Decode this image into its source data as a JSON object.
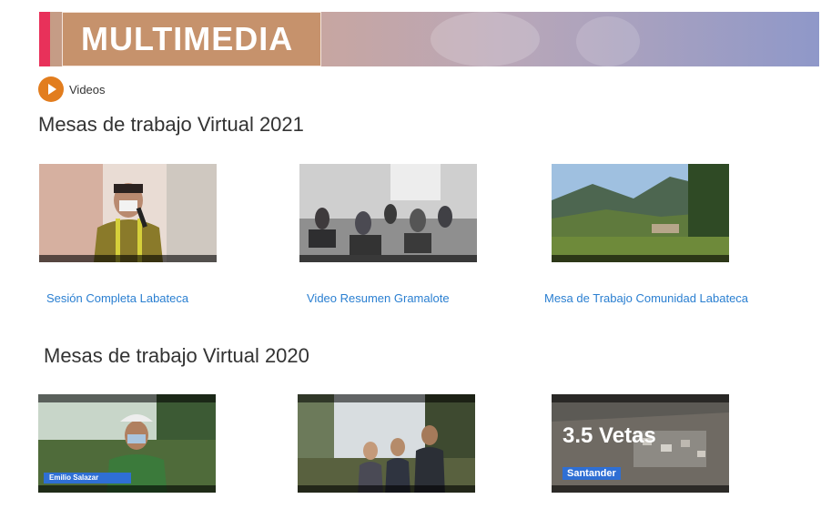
{
  "header": {
    "title": "MULTIMEDIA"
  },
  "videos_label": "Videos",
  "sections": [
    {
      "title": "Mesas de trabajo Virtual 2021",
      "items": [
        {
          "label": "Sesión Completa Labateca"
        },
        {
          "label": "Video Resumen Gramalote"
        },
        {
          "label": "Mesa de Trabajo Comunidad Labateca"
        }
      ]
    },
    {
      "title": "Mesas de trabajo Virtual 2020",
      "items": [
        {
          "overlay": "Emilio Salazar"
        },
        {},
        {
          "big_text": "3.5 Vetas",
          "sub_text": "Santander"
        }
      ]
    }
  ],
  "colors": {
    "accent": "#e8315a",
    "banner_box": "#c6926c",
    "link": "#2a7fd1",
    "play": "#e27d1e"
  }
}
